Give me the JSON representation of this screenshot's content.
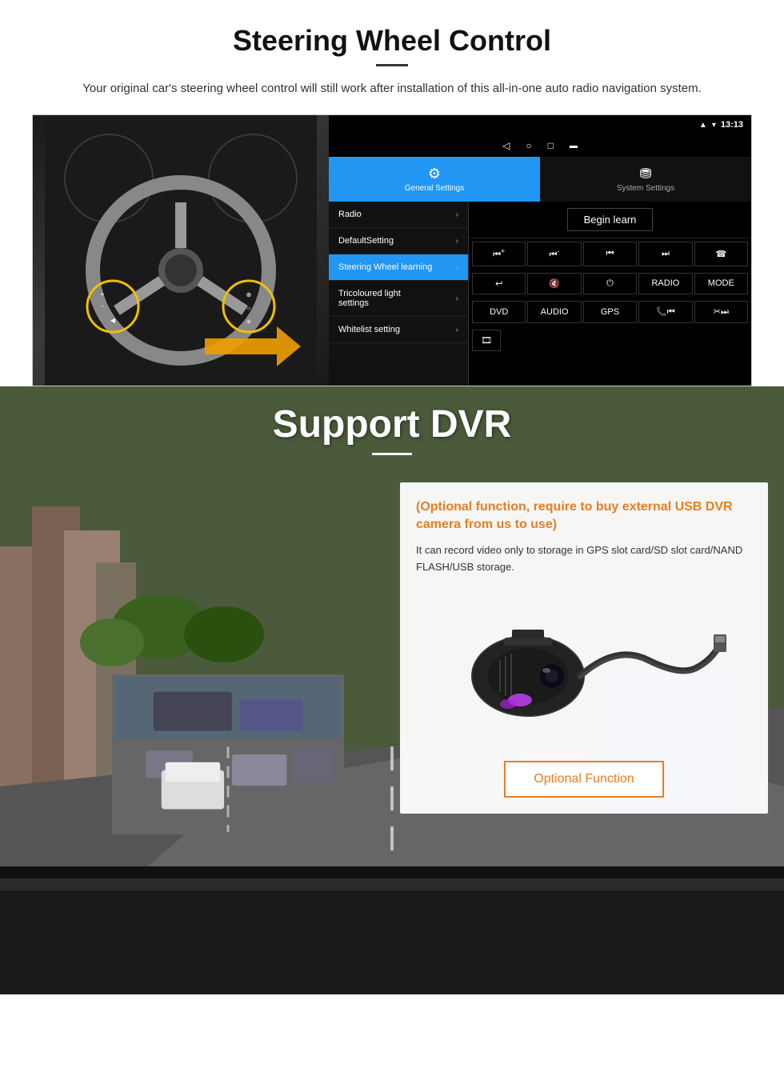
{
  "steering": {
    "title": "Steering Wheel Control",
    "subtitle": "Your original car's steering wheel control will still work after installation of this all-in-one auto radio navigation system.",
    "android": {
      "status_time": "13:13",
      "tab_general_label": "General Settings",
      "tab_system_label": "System Settings",
      "menu_items": [
        {
          "label": "Radio",
          "active": false
        },
        {
          "label": "DefaultSetting",
          "active": false
        },
        {
          "label": "Steering Wheel learning",
          "active": true
        },
        {
          "label": "Tricoloured light settings",
          "active": false
        },
        {
          "label": "Whitelist setting",
          "active": false
        }
      ],
      "begin_learn": "Begin learn",
      "control_buttons_row1": [
        "⏮+",
        "⏮-",
        "⏮",
        "⏭",
        "☎"
      ],
      "control_buttons_row2": [
        "↩",
        "🔇",
        "⏻",
        "RADIO",
        "MODE"
      ],
      "control_buttons_row3": [
        "DVD",
        "AUDIO",
        "GPS",
        "📞⏮",
        "✂⏭"
      ],
      "bottom_icon": "🎞"
    }
  },
  "dvr": {
    "title": "Support DVR",
    "info_title": "(Optional function, require to buy external USB DVR camera from us to use)",
    "info_text": "It can record video only to storage in GPS slot card/SD slot card/NAND FLASH/USB storage.",
    "optional_button_label": "Optional Function"
  }
}
